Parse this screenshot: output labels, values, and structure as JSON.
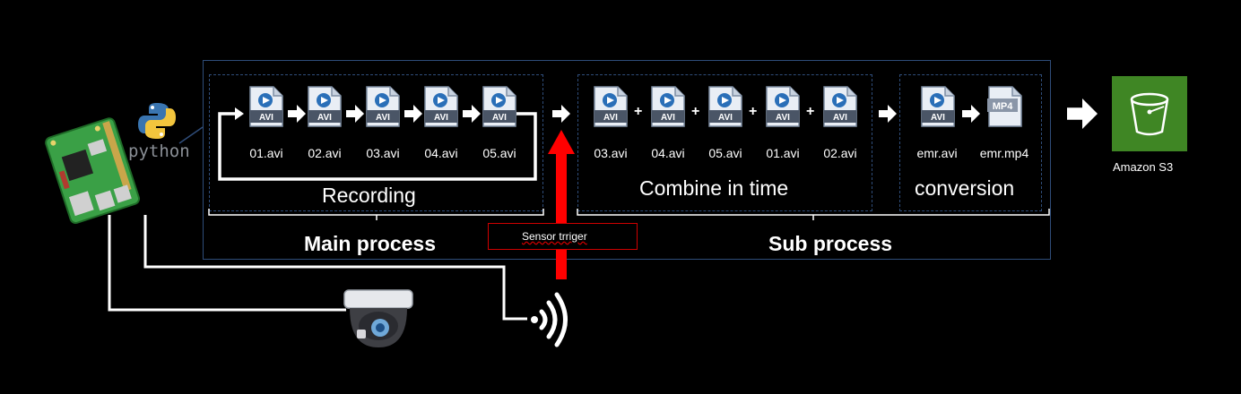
{
  "python_label": "python",
  "recording": {
    "title": "Recording",
    "files": [
      "01.avi",
      "02.avi",
      "03.avi",
      "04.avi",
      "05.avi"
    ],
    "icon_label": "AVI"
  },
  "combine": {
    "title": "Combine in time",
    "files": [
      "03.avi",
      "04.avi",
      "05.avi",
      "01.avi",
      "02.avi"
    ],
    "joiner": "+"
  },
  "conversion": {
    "title": "conversion",
    "input_file": "emr.avi",
    "output_file": "emr.mp4",
    "output_icon_label": "MP4"
  },
  "main_process_label": "Main process",
  "sub_process_label": "Sub process",
  "sensor_trigger_label": "Sensor trriger",
  "s3_label": "Amazon S3",
  "colors": {
    "outline": "#2f4d7a",
    "trigger_arrow": "#ff0000",
    "s3_green": "#3f8624",
    "file_icon_blue": "#2a6fb8"
  }
}
